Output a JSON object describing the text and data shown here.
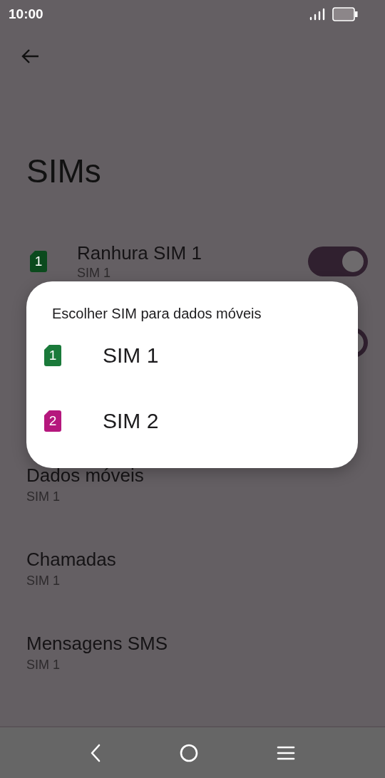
{
  "status_bar": {
    "time": "10:00"
  },
  "title": "SIMs",
  "slots": [
    {
      "name": "Ranhura SIM 1",
      "subtitle": "SIM 1",
      "sim_number": "1",
      "color": "#0b4a1d",
      "on": true
    },
    {
      "on": true
    }
  ],
  "preferences": [
    {
      "name": "Dados móveis",
      "value": "SIM 1"
    },
    {
      "name": "Chamadas",
      "value": "SIM 1"
    },
    {
      "name": "Mensagens SMS",
      "value": "SIM 1"
    }
  ],
  "dialog": {
    "title": "Escolher SIM para dados móveis",
    "options": [
      {
        "sim_number": "1",
        "label": "SIM 1",
        "color": "#1a7a3a"
      },
      {
        "sim_number": "2",
        "label": "SIM 2",
        "color": "#b5177d"
      }
    ]
  }
}
